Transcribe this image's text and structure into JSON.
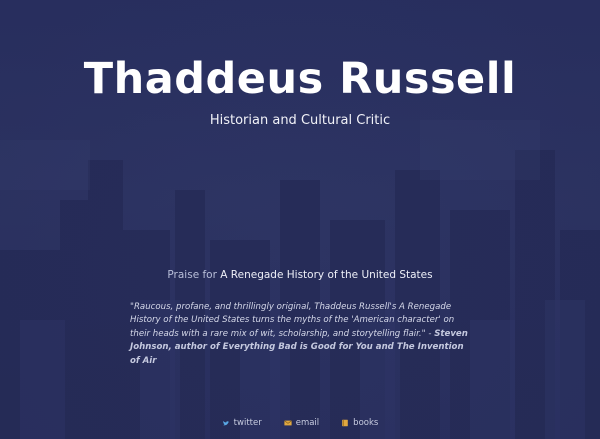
{
  "header": {
    "title": "Thaddeus Russell",
    "subtitle": "Historian and Cultural Critic"
  },
  "praise": {
    "prefix": "Praise for",
    "book_title": "A Renegade History of the United States"
  },
  "quote": {
    "text": "\"Raucous, profane, and thrillingly original, Thaddeus Russell's A Renegade History of the United States turns the myths of the 'American character' on their heads with a rare mix of wit, scholarship, and storytelling flair.\" -",
    "attribution": "Steven Johnson, author of Everything Bad is Good for You and The Invention of Air"
  },
  "footer": {
    "links": [
      {
        "label": "twitter",
        "icon": "twitter-icon"
      },
      {
        "label": "email",
        "icon": "envelope-icon"
      },
      {
        "label": "books",
        "icon": "book-icon"
      }
    ]
  },
  "colors": {
    "background": "#2b3260",
    "text": "#ffffff",
    "twitter_icon": "#5aa9e6",
    "accent_icon": "#e0a840"
  }
}
